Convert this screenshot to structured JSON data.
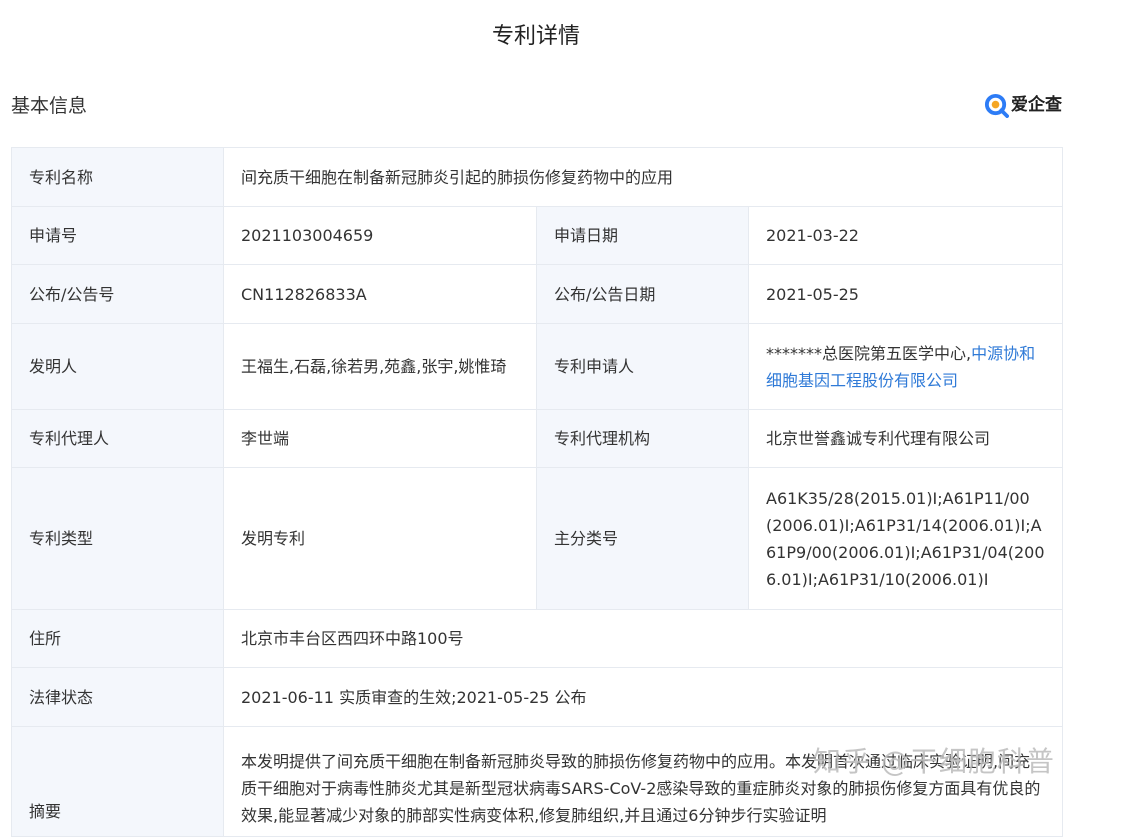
{
  "page": {
    "title": "专利详情",
    "section_title": "基本信息",
    "brand": "爱企查"
  },
  "table": {
    "patent_name": {
      "label": "专利名称",
      "value": "间充质干细胞在制备新冠肺炎引起的肺损伤修复药物中的应用"
    },
    "application_no": {
      "label": "申请号",
      "value": "2021103004659"
    },
    "application_date": {
      "label": "申请日期",
      "value": "2021-03-22"
    },
    "publication_no": {
      "label": "公布/公告号",
      "value": "CN112826833A"
    },
    "publication_date": {
      "label": "公布/公告日期",
      "value": "2021-05-25"
    },
    "inventors": {
      "label": "发明人",
      "value": "王福生,石磊,徐若男,苑鑫,张宇,姚惟琦"
    },
    "applicant": {
      "label": "专利申请人",
      "value_plain": "*******总医院第五医学中心,",
      "value_link": "中源协和细胞基因工程股份有限公司"
    },
    "agent": {
      "label": "专利代理人",
      "value": "李世端"
    },
    "agency": {
      "label": "专利代理机构",
      "value": "北京世誉鑫诚专利代理有限公司"
    },
    "patent_type": {
      "label": "专利类型",
      "value": "发明专利"
    },
    "main_class": {
      "label": "主分类号",
      "value": "A61K35/28(2015.01)I;A61P11/00(2006.01)I;A61P31/14(2006.01)I;A61P9/00(2006.01)I;A61P31/04(2006.01)I;A61P31/10(2006.01)I"
    },
    "address": {
      "label": "住所",
      "value": "北京市丰台区西四环中路100号"
    },
    "legal_status": {
      "label": "法律状态",
      "value": "2021-06-11 实质审查的生效;2021-05-25 公布"
    },
    "abstract": {
      "label": "摘要",
      "value": "本发明提供了间充质干细胞在制备新冠肺炎导致的肺损伤修复药物中的应用。本发明首次通过临床实验证明,间充质干细胞对于病毒性肺炎尤其是新型冠状病毒SARS-CoV-2感染导致的重症肺炎对象的肺损伤修复方面具有优良的效果,能显著减少对象的肺部实性病变体积,修复肺组织,并且通过6分钟步行实验证明"
    }
  },
  "watermark": "知乎 @干细胞科普",
  "colors": {
    "label_bg": "#f4f7fc",
    "border": "#e6eaf0",
    "link": "#2f7ad7",
    "brand_icon": "#2d7cf6"
  }
}
